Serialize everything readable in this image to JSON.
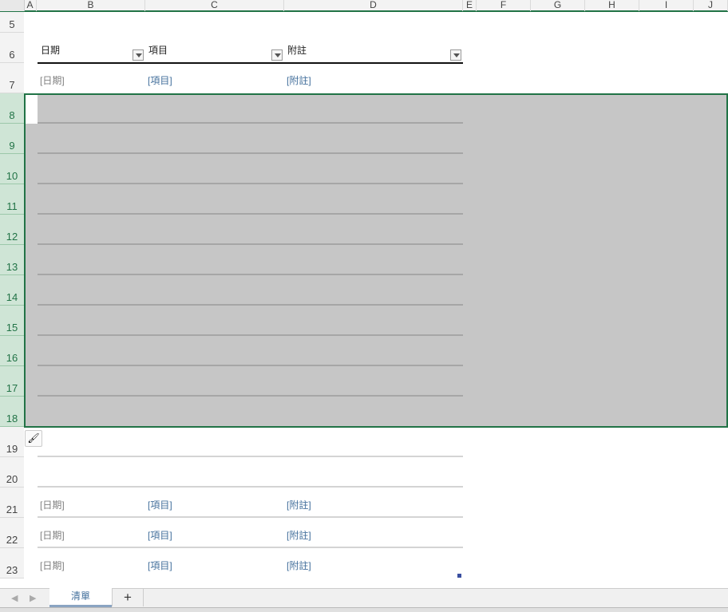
{
  "columns": [
    "A",
    "B",
    "C",
    "D",
    "E",
    "F",
    "G",
    "H",
    "I",
    "J"
  ],
  "rows": [
    "5",
    "6",
    "7",
    "8",
    "9",
    "10",
    "11",
    "12",
    "13",
    "14",
    "15",
    "16",
    "17",
    "18",
    "19",
    "20",
    "21",
    "22",
    "23"
  ],
  "table": {
    "headers": [
      "日期",
      "項目",
      "附註"
    ],
    "placeholder_rows": [
      {
        "row": "7",
        "date": "[日期]",
        "item": "[項目]",
        "note": "[附註]"
      },
      {
        "row": "21",
        "date": "[日期]",
        "item": "[項目]",
        "note": "[附註]"
      },
      {
        "row": "22",
        "date": "[日期]",
        "item": "[項目]",
        "note": "[附註]"
      },
      {
        "row": "23",
        "date": "[日期]",
        "item": "[項目]",
        "note": "[附註]"
      }
    ]
  },
  "selection": {
    "rows": "8:18"
  },
  "sheet_tabs": {
    "tabs": [
      "清單"
    ],
    "active": "清單",
    "add_label": "+"
  },
  "colors": {
    "accent": "#217346",
    "selection_fill": "#c6c6c6",
    "placeholder_blue": "#44709c"
  }
}
